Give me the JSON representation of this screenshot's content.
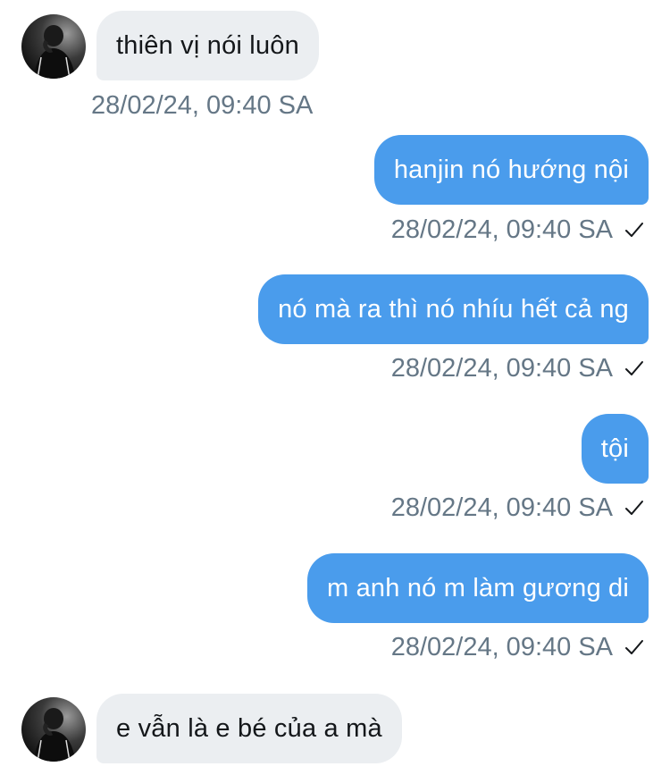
{
  "messages": [
    {
      "text": "thiên vị nói luôn",
      "timestamp": "28/02/24, 09:40 SA",
      "direction": "received"
    },
    {
      "text": "hanjin nó hướng nội",
      "timestamp": "28/02/24, 09:40 SA",
      "direction": "sent"
    },
    {
      "text": "nó mà ra thì nó nhíu hết cả ng",
      "timestamp": "28/02/24, 09:40 SA",
      "direction": "sent"
    },
    {
      "text": "tội",
      "timestamp": "28/02/24, 09:40 SA",
      "direction": "sent"
    },
    {
      "text": "m anh nó m làm gương di",
      "timestamp": "28/02/24, 09:40 SA",
      "direction": "sent"
    },
    {
      "text": "e vẫn là e bé của a mà",
      "direction": "received"
    }
  ],
  "colors": {
    "sent_bubble": "#4a9cec",
    "received_bubble": "#ebeef1",
    "timestamp_text": "#657786"
  },
  "icons": {
    "avatar": "avatar-image",
    "read_receipt": "checkmark-icon"
  }
}
